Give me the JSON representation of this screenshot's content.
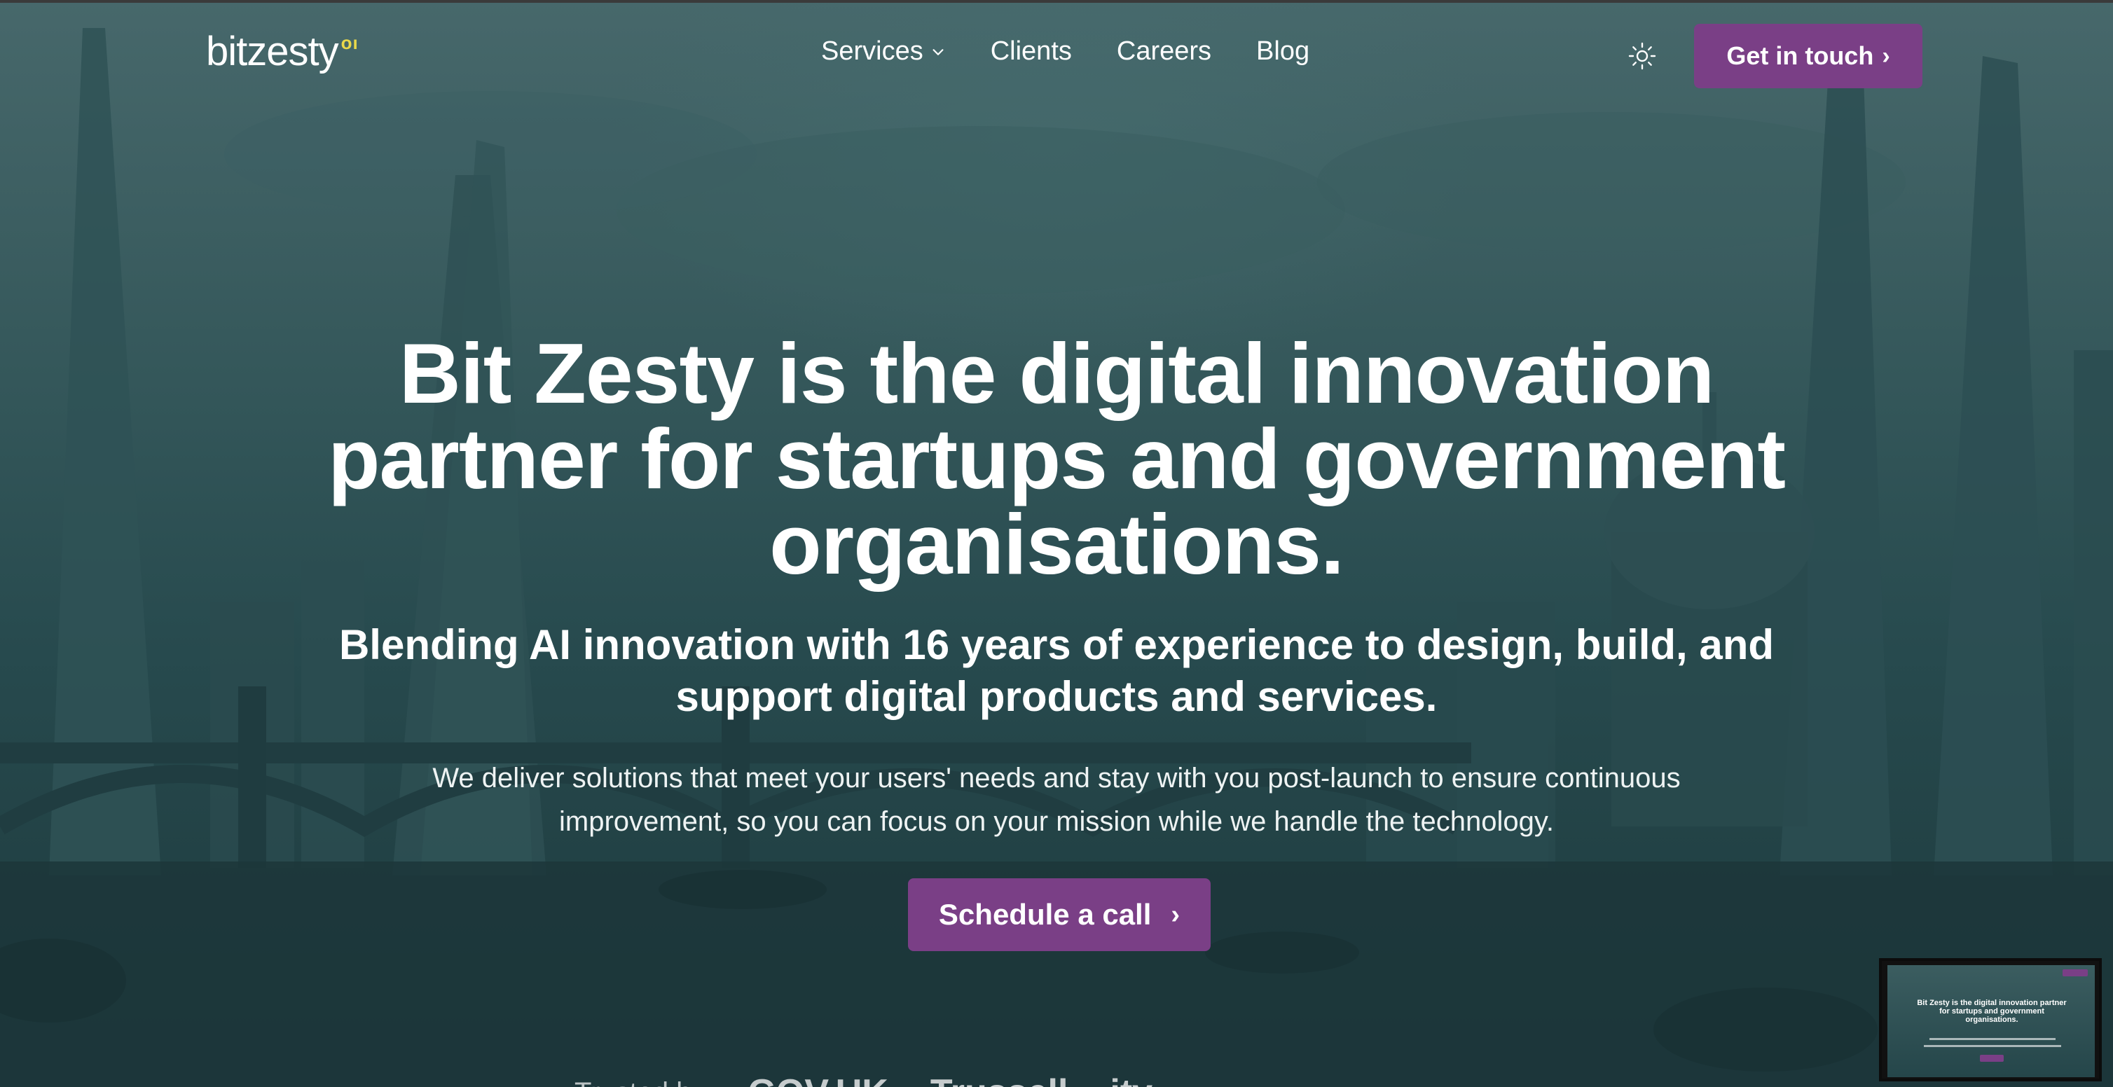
{
  "header": {
    "logo_text": "bitzesty",
    "logo_mark": "oı",
    "nav": [
      {
        "label": "Services",
        "has_dropdown": true,
        "icon": "chevron-down-icon"
      },
      {
        "label": "Clients"
      },
      {
        "label": "Careers"
      },
      {
        "label": "Blog"
      }
    ],
    "theme_toggle_icon": "sun-icon",
    "cta_label": "Get in touch",
    "cta_icon": "chevron-right-icon"
  },
  "hero": {
    "headline": "Bit Zesty is the digital innovation partner for startups and government organisations.",
    "subheadline": "Blending AI innovation with 16 years of experience to design, build, and support digital products and services.",
    "body": "We deliver solutions that meet your users' needs and stay with you post-launch to ensure continuous improvement, so you can focus on your mission while we handle the technology.",
    "cta_label": "Schedule a call",
    "cta_icon": "chevron-right-icon"
  },
  "trusted": {
    "label": "Trusted by",
    "logos": [
      "GOV.UK",
      "Trussell",
      "itv"
    ]
  },
  "preview": {
    "title": "Bit Zesty is the digital innovation partner for startups and government organisations."
  },
  "colors": {
    "accent": "#7a3f86",
    "logo_mark": "#e9d84a",
    "overlay": "#274a4e"
  }
}
